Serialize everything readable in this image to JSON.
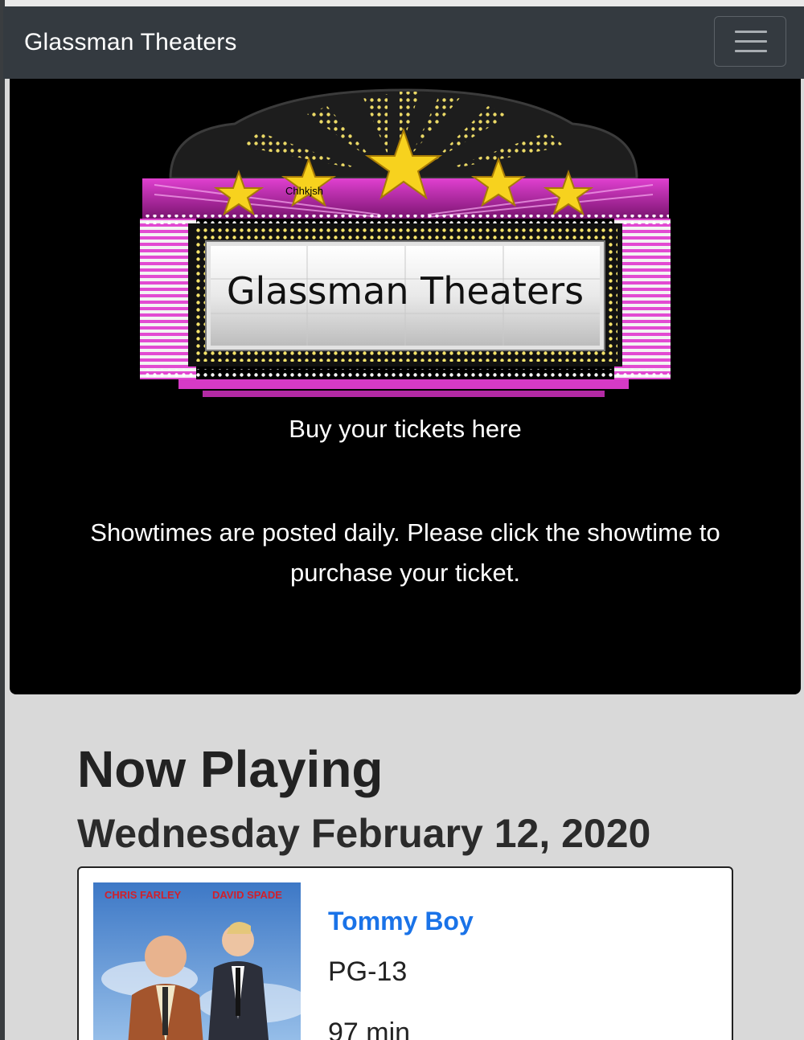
{
  "navbar": {
    "brand": "Glassman Theaters",
    "toggler_icon": "hamburger-menu-icon"
  },
  "hero": {
    "marquee_sign_text": "Glassman Theaters",
    "marquee_small_text": "Chhkjsh",
    "subtitle": "Buy your tickets here",
    "description": "Showtimes are posted daily. Please click the showtime to purchase your ticket."
  },
  "now_playing": {
    "heading": "Now Playing",
    "date": "Wednesday February 12, 2020",
    "movies": [
      {
        "title": "Tommy Boy",
        "rating": "PG-13",
        "runtime": "97 min",
        "poster_left_name": "CHRIS FARLEY",
        "poster_right_name": "DAVID SPADE"
      }
    ]
  },
  "colors": {
    "navbar_bg": "#343a40",
    "hero_bg": "#000000",
    "page_bg": "#d9d9d9",
    "link": "#1a73e8",
    "marquee_magenta": "#c026b0",
    "marquee_star": "#f7d21e"
  }
}
